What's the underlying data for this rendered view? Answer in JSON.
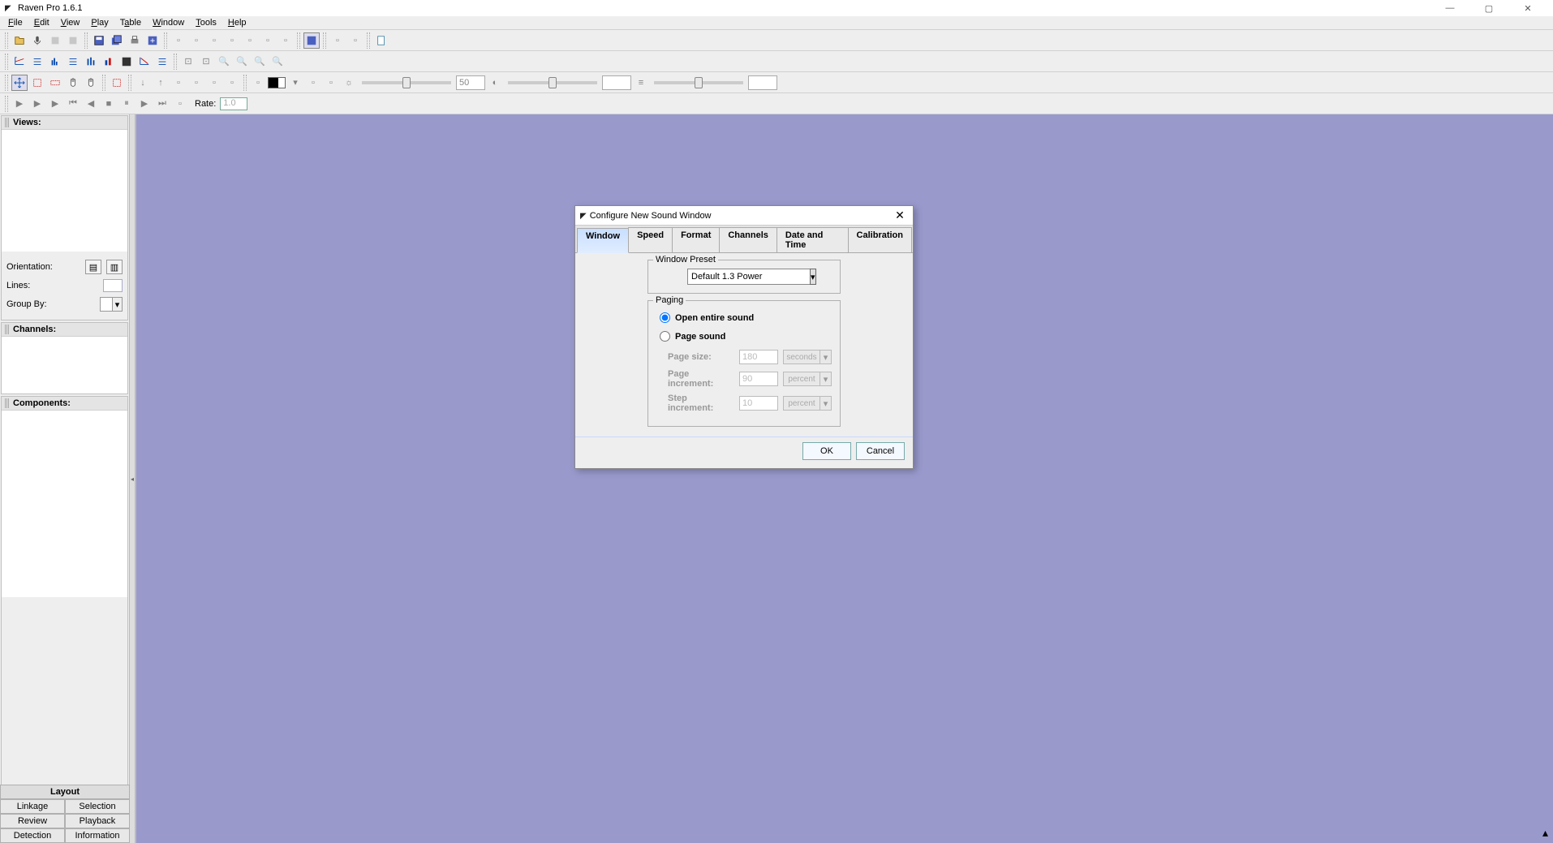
{
  "app": {
    "title": "Raven Pro 1.6.1"
  },
  "menus": [
    "File",
    "Edit",
    "View",
    "Play",
    "Table",
    "Window",
    "Tools",
    "Help"
  ],
  "sliders": {
    "brightness": "50",
    "contrast": "",
    "third": ""
  },
  "rate": {
    "label": "Rate:",
    "value": "1.0"
  },
  "sidebar": {
    "views_label": "Views:",
    "orientation_label": "Orientation:",
    "lines_label": "Lines:",
    "groupby_label": "Group By:",
    "channels_label": "Channels:",
    "components_label": "Components:"
  },
  "bottom_tabs": {
    "layout": "Layout",
    "linkage": "Linkage",
    "selection": "Selection",
    "review": "Review",
    "playback": "Playback",
    "detection": "Detection",
    "information": "Information"
  },
  "dialog": {
    "title": "Configure New Sound Window",
    "tabs": [
      "Window",
      "Speed",
      "Format",
      "Channels",
      "Date and Time",
      "Calibration"
    ],
    "active_tab": 0,
    "window_preset": {
      "legend": "Window Preset",
      "value": "Default 1.3 Power"
    },
    "paging": {
      "legend": "Paging",
      "open_entire": "Open entire sound",
      "page_sound": "Page sound",
      "page_size_label": "Page size:",
      "page_size_value": "180",
      "page_size_unit": "seconds",
      "page_incr_label": "Page increment:",
      "page_incr_value": "90",
      "page_incr_unit": "percent",
      "step_incr_label": "Step increment:",
      "step_incr_value": "10",
      "step_incr_unit": "percent"
    },
    "ok": "OK",
    "cancel": "Cancel"
  }
}
